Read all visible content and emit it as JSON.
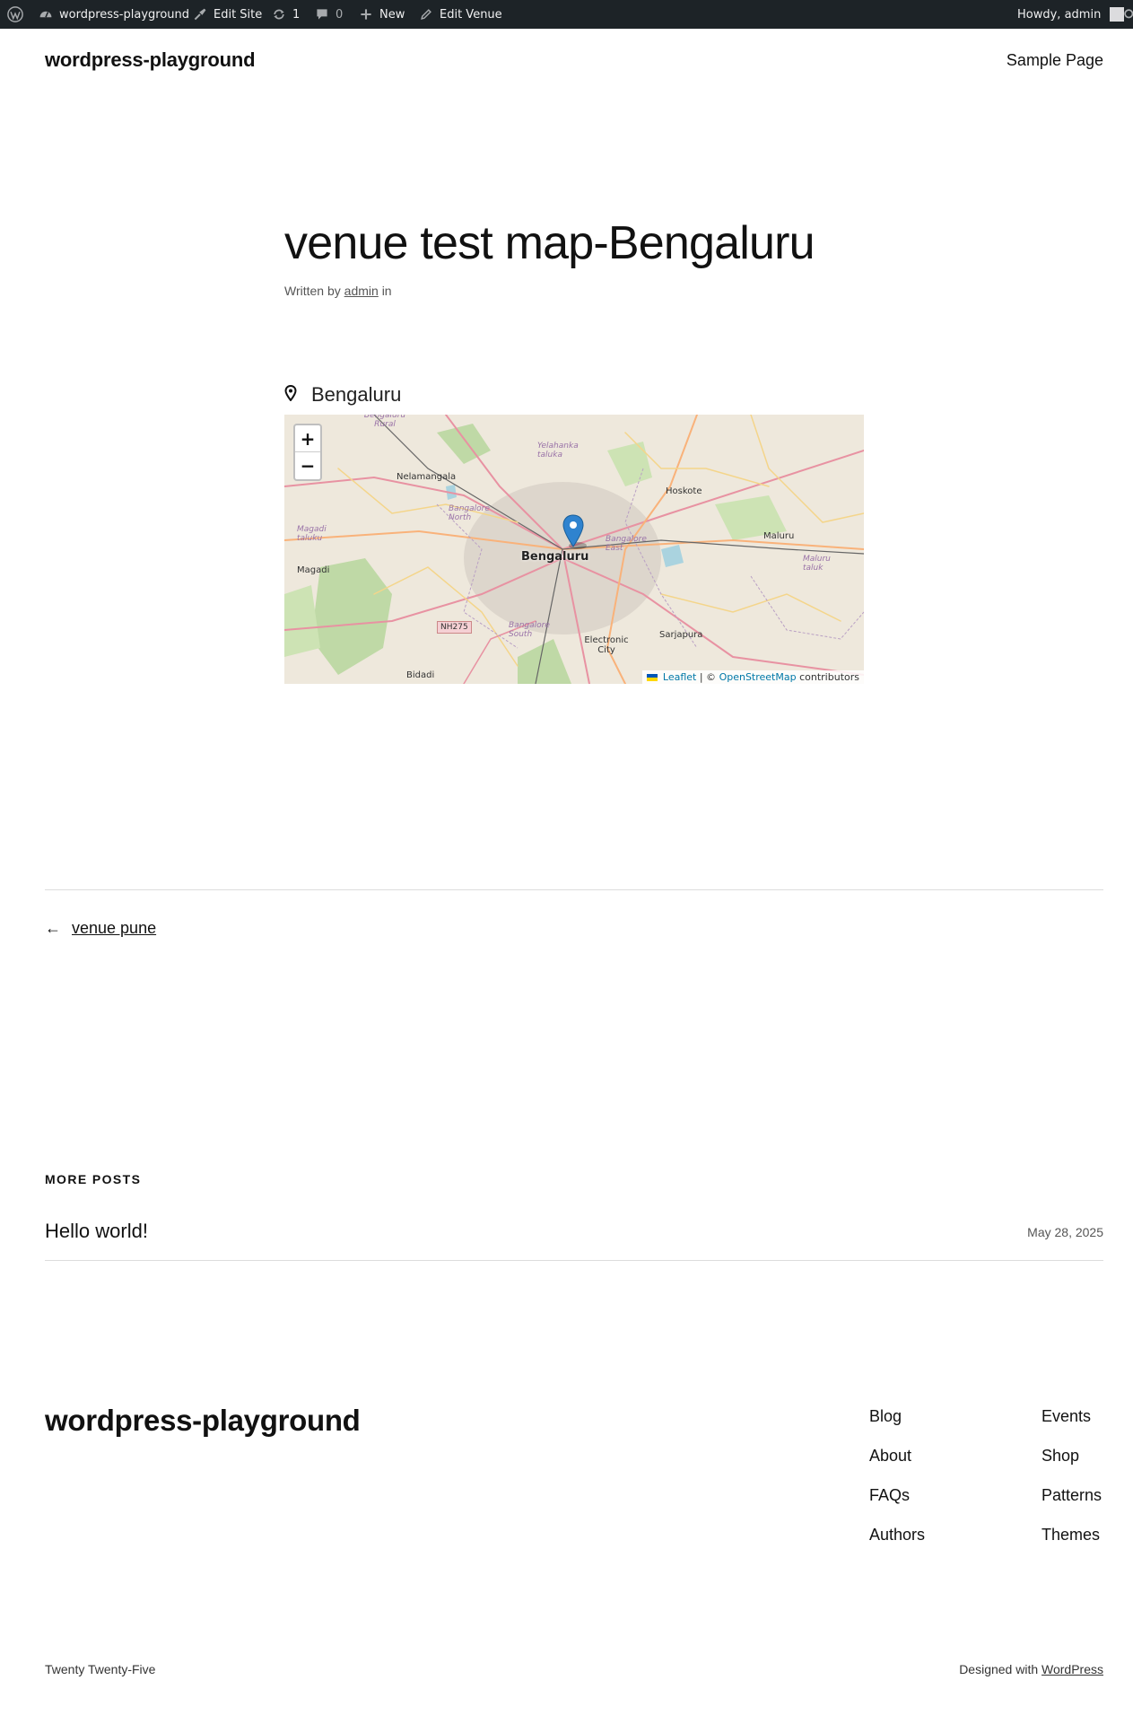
{
  "admin_bar": {
    "site_name": "wordpress-playground",
    "edit_site": "Edit Site",
    "updates_count": "1",
    "comments_count": "0",
    "new_label": "New",
    "edit_venue": "Edit Venue",
    "greeting": "Howdy, admin"
  },
  "header": {
    "site_title": "wordpress-playground",
    "nav_link": "Sample Page"
  },
  "post": {
    "title": "venue test map-Bengaluru",
    "meta_prefix": "Written by",
    "author": "admin",
    "meta_suffix": "in",
    "venue_name": "Bengaluru"
  },
  "map": {
    "zoom_in": "+",
    "zoom_out": "−",
    "city_label": "Bengaluru",
    "places": {
      "nelamangala": "Nelamangala",
      "hoskote": "Hoskote",
      "magadi": "Magadi",
      "magadi_taluk": "Magadi taluku",
      "maluru": "Maluru",
      "maluru_taluk": "Maluru taluk",
      "bangalore_north": "Bangalore North",
      "bangalore_east": "Bangalore East",
      "bangalore_south": "Bangalore South",
      "yelahanka": "Yelahanka taluka",
      "electronic_city": "Electronic City",
      "sarjapura": "Sarjapura",
      "bidadi": "Bidadi",
      "rural": "Bengaluru Rural",
      "nh": "NH275"
    },
    "attribution_leaflet": "Leaflet",
    "attribution_sep": "| ©",
    "attribution_osm": "OpenStreetMap",
    "attribution_tail": "contributors"
  },
  "post_nav": {
    "arrow": "←",
    "previous": "venue pune"
  },
  "more_posts": {
    "heading": "MORE POSTS",
    "items": [
      {
        "title": "Hello world!",
        "date": "May 28, 2025"
      }
    ]
  },
  "footer": {
    "site_title": "wordpress-playground",
    "col1": [
      "Blog",
      "About",
      "FAQs",
      "Authors"
    ],
    "col2": [
      "Events",
      "Shop",
      "Patterns",
      "Themes"
    ],
    "theme_name": "Twenty Twenty-Five",
    "designed_prefix": "Designed with",
    "designed_link": "WordPress"
  }
}
